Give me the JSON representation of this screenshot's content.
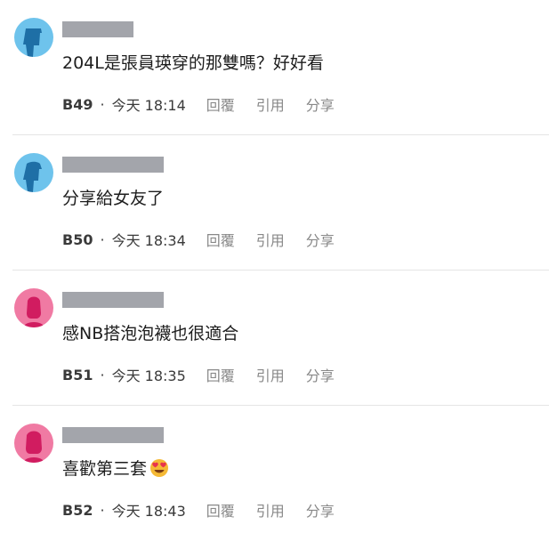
{
  "comments": [
    {
      "floor": "B49",
      "separator": "·",
      "time": "今天 18:14",
      "content": "204L是張員瑛穿的那雙嗎？好好看",
      "avatar_color": "#6ec3ec",
      "avatar_icon": "blue-user-icon",
      "emoji": ""
    },
    {
      "floor": "B50",
      "separator": "·",
      "time": "今天 18:34",
      "content": "分享給女友了",
      "avatar_color": "#6ec3ec",
      "avatar_icon": "blue-user-icon",
      "emoji": ""
    },
    {
      "floor": "B51",
      "separator": "·",
      "time": "今天 18:35",
      "content": "感NB搭泡泡襪也很適合",
      "avatar_color": "#f07aa3",
      "avatar_icon": "pink-user-icon",
      "emoji": ""
    },
    {
      "floor": "B52",
      "separator": "·",
      "time": "今天 18:43",
      "content": "喜歡第三套",
      "avatar_color": "#f07aa3",
      "avatar_icon": "pink-user-icon",
      "emoji": "heart-eyes-emoji"
    }
  ],
  "actions": {
    "reply": "回覆",
    "quote": "引用",
    "share": "分享"
  }
}
